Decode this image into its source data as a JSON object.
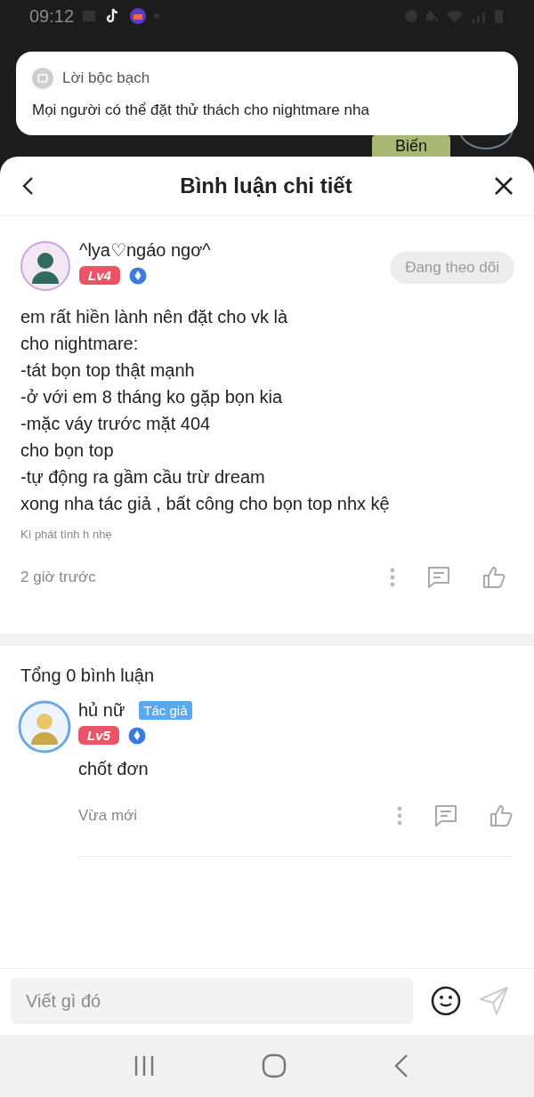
{
  "status_bar": {
    "time": "09:12"
  },
  "background": {
    "button": "Biến"
  },
  "notification": {
    "app": "Lời bộc bạch",
    "message": "Mọi người có thể đặt thử thách cho nightmare nha"
  },
  "sheet": {
    "title": "Bình luận chi tiết"
  },
  "comment": {
    "author": "^lya♡ngáo ngơ^",
    "level": "Lv4",
    "follow": {
      "label": "Đang theo dõi",
      "following": true
    },
    "body": "em rất hiền lành nên đặt cho vk là\ncho nightmare:\n-tát bọn top thật mạnh\n-ở với em 8 tháng ko gặp bọn kia\n-mặc váy trước mặt 404\ncho bọn top\n-tự động ra gầm cầu trừ dream\nxong nha tác giả , bất công cho bọn top nhx kệ",
    "signature": "Kì phát tình h nhẹ",
    "time": "2 giờ trước"
  },
  "replies_count": "Tổng 0 bình luận",
  "replies": [
    {
      "author": "hủ nữ",
      "tag": "Tác giả",
      "level": "Lv5",
      "text": "chốt đơn",
      "time": "Vừa mới"
    }
  ],
  "composer": {
    "placeholder": "Viết gì đó"
  }
}
